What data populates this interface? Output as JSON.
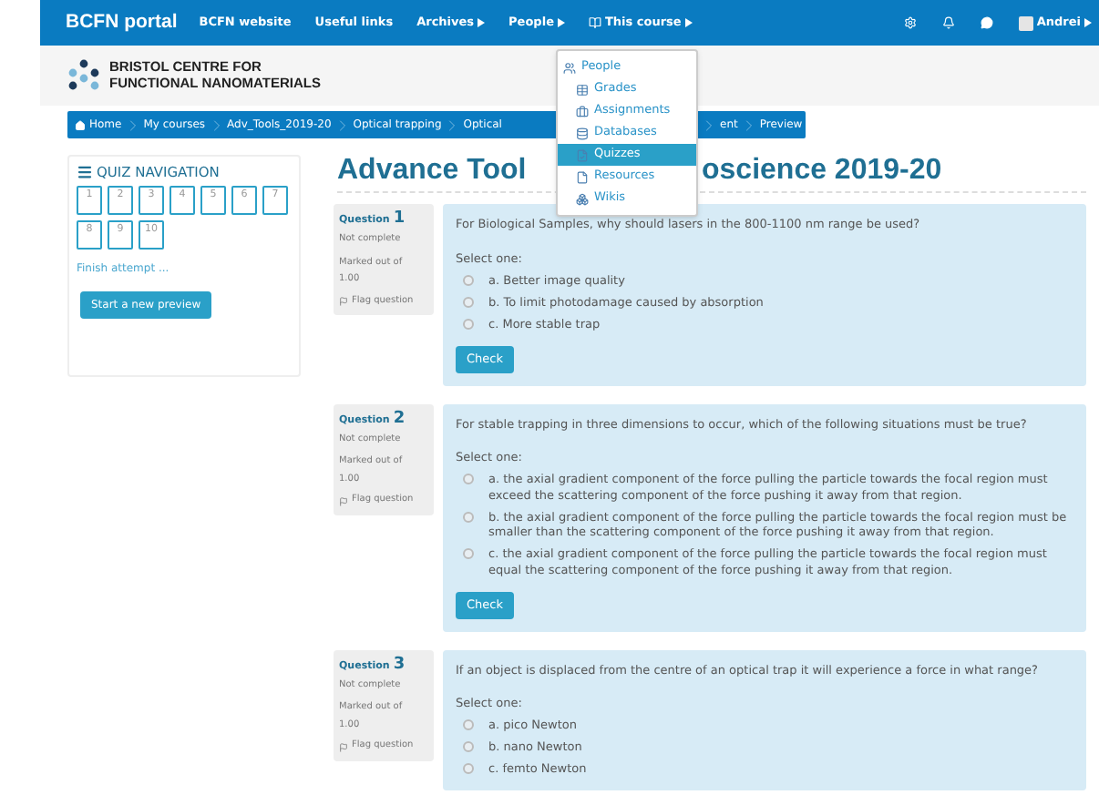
{
  "navbar": {
    "brand": "BCFN portal",
    "links": [
      {
        "label": "BCFN website",
        "kind": "link"
      },
      {
        "label": "Useful links",
        "kind": "link"
      },
      {
        "label": "Archives",
        "kind": "dropdown"
      },
      {
        "label": "People",
        "kind": "dropdown"
      },
      {
        "label": "This course",
        "kind": "course"
      }
    ],
    "user": "Andrei"
  },
  "header": {
    "logo_lines": [
      "BRISTOL CENTRE FOR",
      "FUNCTIONAL NANOMATERIALS"
    ]
  },
  "breadcrumb": [
    {
      "label": "Home",
      "kind": "home"
    },
    {
      "label": "My courses",
      "kind": "link"
    },
    {
      "label": "Adv_Tools_2019-20",
      "kind": "link"
    },
    {
      "label": "Optical trapping",
      "kind": "link"
    },
    {
      "label": "Optical",
      "kind": "link"
    },
    {
      "label": "ent",
      "kind": "covered"
    },
    {
      "label": "Preview",
      "kind": "link"
    }
  ],
  "course_menu": [
    {
      "label": "People",
      "selected": false
    },
    {
      "label": "Grades",
      "selected": false
    },
    {
      "label": "Assignments",
      "selected": false
    },
    {
      "label": "Databases",
      "selected": false
    },
    {
      "label": "Quizzes",
      "selected": true
    },
    {
      "label": "Resources",
      "selected": false
    },
    {
      "label": "Wikis",
      "selected": false
    }
  ],
  "quiz_navigation": {
    "title": "QUIZ NAVIGATION",
    "questions": [
      "1",
      "2",
      "3",
      "4",
      "5",
      "6",
      "7",
      "8",
      "9",
      "10"
    ],
    "finish_link": "Finish attempt ...",
    "button": "Start a new preview"
  },
  "title_parts": [
    "Advance Tool",
    "oscience 2019-20"
  ],
  "questions": [
    {
      "label": "Question",
      "number": "1",
      "status": "Not complete",
      "marked": "Marked out of",
      "mark": "1.00",
      "flag": "Flag question",
      "text": "For Biological Samples, why should lasers in the 800-1100 nm range be used?",
      "prompt": "Select one:",
      "options": [
        {
          "text": "a. Better image quality",
          "selected": false
        },
        {
          "text": "b. To limit photodamage caused by absorption",
          "selected": false
        },
        {
          "text": "c. More stable trap",
          "selected": false
        }
      ],
      "button": "Check"
    },
    {
      "label": "Question",
      "number": "2",
      "status": "Not complete",
      "marked": "Marked out of",
      "mark": "1.00",
      "flag": "Flag question",
      "text": "For stable trapping in three dimensions to occur, which of the following situations must be true?",
      "prompt": "Select one:",
      "options": [
        {
          "text": "a. the axial gradient component of the force pulling the particle towards the focal region must exceed the scattering component of the force pushing it away from that region.",
          "selected": false
        },
        {
          "text": "b. the axial gradient component of the force pulling the particle towards the focal region must be smaller than the scattering component of the force pushing it away from that region.",
          "selected": false
        },
        {
          "text": "c. the axial gradient component of the force pulling the particle towards the focal region must equal the scattering component of the force pushing it away from that region.",
          "selected": false
        }
      ],
      "button": "Check"
    },
    {
      "label": "Question",
      "number": "3",
      "status": "Not complete",
      "marked": "Marked out of",
      "mark": "1.00",
      "flag": "Flag question",
      "text": "If an object is displaced from the centre of an optical trap it will experience a force in what range?",
      "prompt": "Select one:",
      "options": [
        {
          "text": "a. pico Newton",
          "selected": false
        },
        {
          "text": "b. nano Newton",
          "selected": false
        },
        {
          "text": "c. femto Newton",
          "selected": false
        }
      ]
    }
  ]
}
